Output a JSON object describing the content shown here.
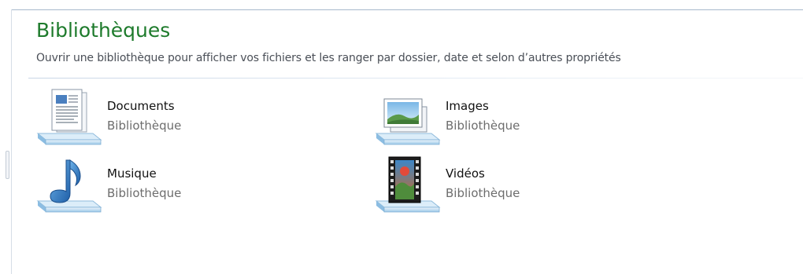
{
  "header": {
    "title": "Bibliothèques",
    "subtitle": "Ouvrir une bibliothèque pour afficher vos fichiers et les ranger par dossier, date et selon d’autres propriétés"
  },
  "libraries": [
    {
      "name": "Documents",
      "type": "Bibliothèque",
      "icon": "documents-library-icon"
    },
    {
      "name": "Images",
      "type": "Bibliothèque",
      "icon": "images-library-icon"
    },
    {
      "name": "Musique",
      "type": "Bibliothèque",
      "icon": "music-library-icon"
    },
    {
      "name": "Vidéos",
      "type": "Bibliothèque",
      "icon": "videos-library-icon"
    }
  ],
  "colors": {
    "title": "#1e7b2c",
    "subtitle": "#4a4f57",
    "border": "#a7b8cc"
  }
}
